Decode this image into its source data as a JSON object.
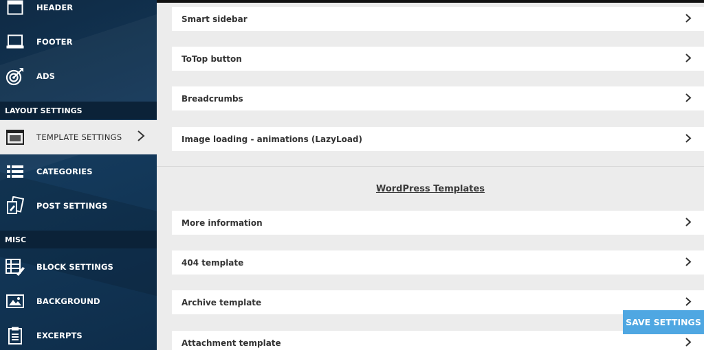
{
  "sidebar": {
    "items": [
      {
        "label": "HEADER",
        "icon": "header-icon"
      },
      {
        "label": "FOOTER",
        "icon": "footer-icon"
      },
      {
        "label": "ADS",
        "icon": "target-icon"
      },
      {
        "label": "TEMPLATE SETTINGS",
        "icon": "template-window-icon",
        "active": true
      },
      {
        "label": "CATEGORIES",
        "icon": "list-icon"
      },
      {
        "label": "POST SETTINGS",
        "icon": "post-settings-icon"
      },
      {
        "label": "BLOCK SETTINGS",
        "icon": "block-settings-icon"
      },
      {
        "label": "BACKGROUND",
        "icon": "image-icon"
      },
      {
        "label": "EXCERPTS",
        "icon": "document-icon"
      }
    ],
    "sections": {
      "layout": "LAYOUT SETTINGS",
      "misc": "MISC"
    }
  },
  "main": {
    "rows_top": [
      {
        "label": "Smart sidebar"
      },
      {
        "label": "ToTop button"
      },
      {
        "label": "Breadcrumbs"
      },
      {
        "label": "Image loading - animations (LazyLoad)"
      }
    ],
    "section_title": "WordPress Templates",
    "rows_bottom": [
      {
        "label": "More information"
      },
      {
        "label": "404 template"
      },
      {
        "label": "Archive template"
      },
      {
        "label": "Attachment template"
      }
    ]
  },
  "actions": {
    "save_label": "SAVE SETTINGS"
  },
  "colors": {
    "sidebar_bg": "#143a5c",
    "section_head_bg": "#0b2238",
    "content_bg": "#ececec",
    "save_button": "#4fa7e2"
  }
}
